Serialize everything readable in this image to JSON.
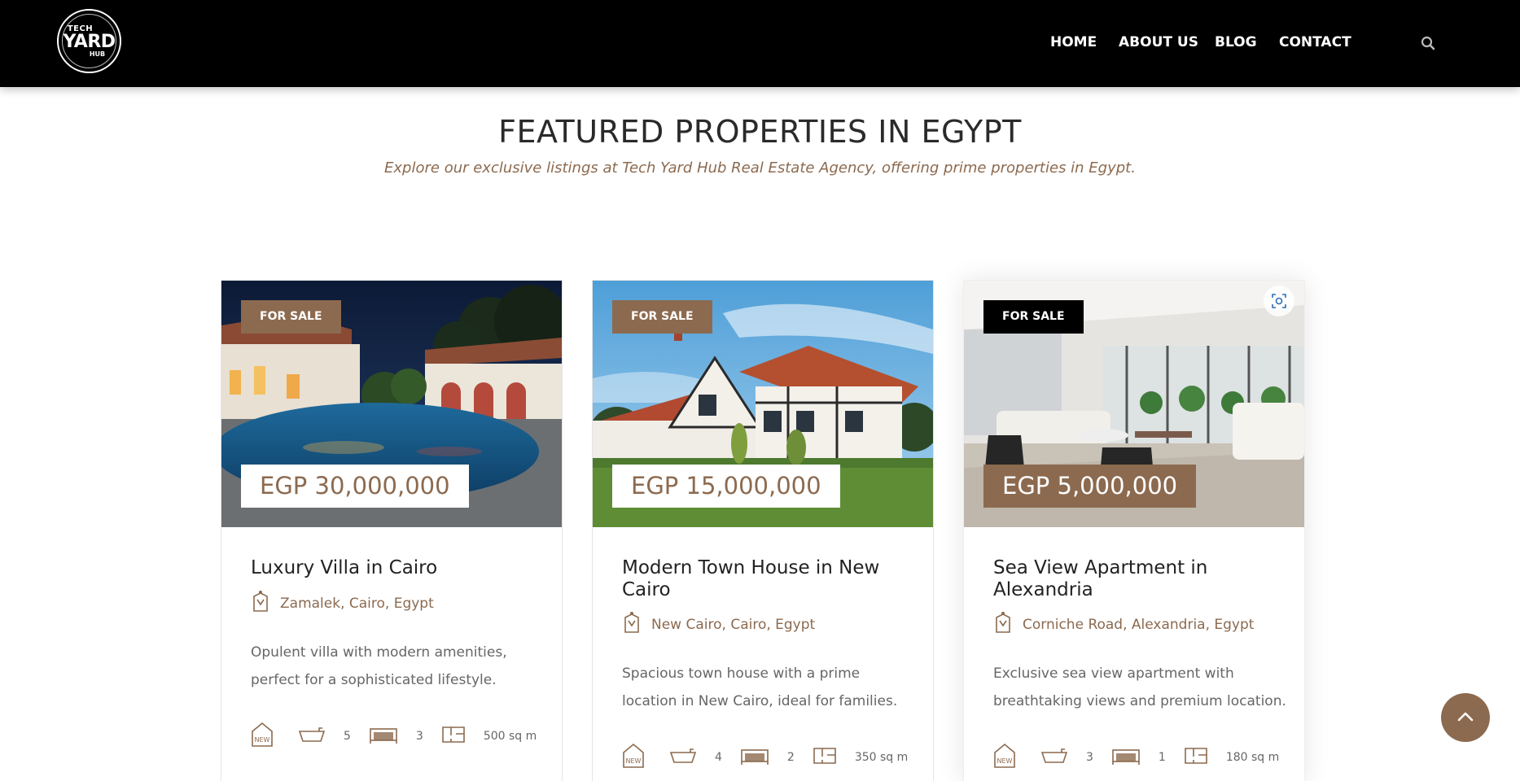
{
  "logo": {
    "line1": "TECH",
    "line2": "YARD",
    "line3": "HUB"
  },
  "nav": [
    {
      "label": "HOME"
    },
    {
      "label": "ABOUT US"
    },
    {
      "label": "BLOG"
    },
    {
      "label": "CONTACT"
    }
  ],
  "section": {
    "title": "FEATURED PROPERTIES IN EGYPT",
    "subtitle": "Explore our exclusive listings at Tech Yard Hub Real Estate Agency, offering prime properties in Egypt."
  },
  "colors": {
    "accent": "#8c6a4f",
    "header_bg": "#000000"
  },
  "properties": [
    {
      "badge": "FOR SALE",
      "price": "EGP 30,000,000",
      "title": "Luxury Villa in Cairo",
      "location": "Zamalek, Cairo, Egypt",
      "description": "Opulent villa with modern amenities, perfect for a sophisticated lifestyle.",
      "bathrooms": "5",
      "bedrooms": "3",
      "area": "500 sq m"
    },
    {
      "badge": "FOR SALE",
      "price": "EGP 15,000,000",
      "title": "Modern Town House in New Cairo",
      "location": "New Cairo, Cairo, Egypt",
      "description": "Spacious town house with a prime location in New Cairo, ideal for families.",
      "bathrooms": "4",
      "bedrooms": "2",
      "area": "350 sq m"
    },
    {
      "badge": "FOR SALE",
      "price": "EGP 5,000,000",
      "title": "Sea View Apartment in Alexandria",
      "location": "Corniche Road, Alexandria, Egypt",
      "description": "Exclusive sea view apartment with breathtaking views and premium location.",
      "bathrooms": "3",
      "bedrooms": "1",
      "area": "180 sq m"
    }
  ]
}
